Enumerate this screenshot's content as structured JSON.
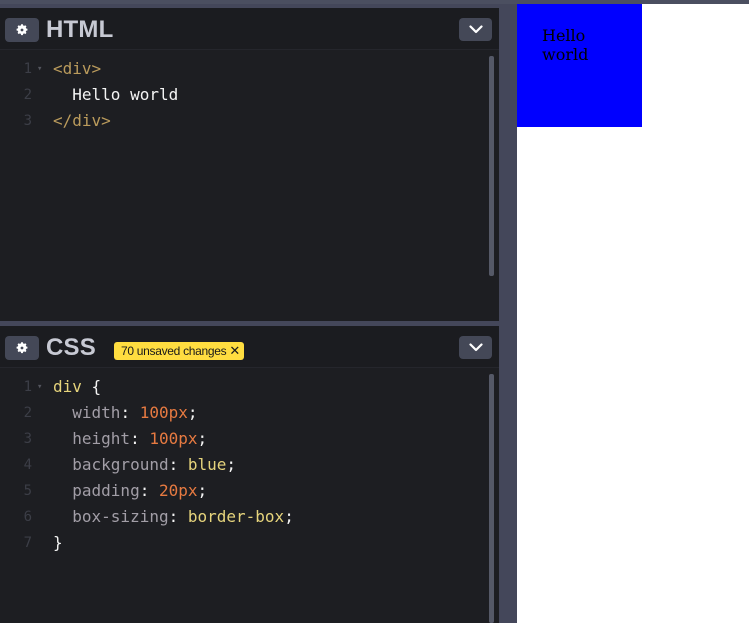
{
  "html_panel": {
    "title": "HTML",
    "lines": [
      {
        "num": "1",
        "fold": "▾",
        "tokens": [
          {
            "cls": "t-tag",
            "text": "<div>"
          }
        ]
      },
      {
        "num": "2",
        "fold": "",
        "tokens": [
          {
            "cls": "t-text",
            "text": "  Hello world"
          }
        ]
      },
      {
        "num": "3",
        "fold": "",
        "tokens": [
          {
            "cls": "t-tag",
            "text": "</div>"
          }
        ]
      }
    ]
  },
  "css_panel": {
    "title": "CSS",
    "badge": "70 unsaved changes",
    "badge_close": "✕",
    "lines": [
      {
        "num": "1",
        "fold": "▾",
        "tokens": [
          {
            "cls": "t-selector",
            "text": "div "
          },
          {
            "cls": "t-punc",
            "text": "{"
          }
        ]
      },
      {
        "num": "2",
        "fold": "",
        "tokens": [
          {
            "cls": "t-prop",
            "text": "  width"
          },
          {
            "cls": "t-punc",
            "text": ": "
          },
          {
            "cls": "t-num",
            "text": "100px"
          },
          {
            "cls": "t-punc",
            "text": ";"
          }
        ]
      },
      {
        "num": "3",
        "fold": "",
        "tokens": [
          {
            "cls": "t-prop",
            "text": "  height"
          },
          {
            "cls": "t-punc",
            "text": ": "
          },
          {
            "cls": "t-num",
            "text": "100px"
          },
          {
            "cls": "t-punc",
            "text": ";"
          }
        ]
      },
      {
        "num": "4",
        "fold": "",
        "tokens": [
          {
            "cls": "t-prop",
            "text": "  background"
          },
          {
            "cls": "t-punc",
            "text": ": "
          },
          {
            "cls": "t-val",
            "text": "blue"
          },
          {
            "cls": "t-punc",
            "text": ";"
          }
        ]
      },
      {
        "num": "5",
        "fold": "",
        "tokens": [
          {
            "cls": "t-prop",
            "text": "  padding"
          },
          {
            "cls": "t-punc",
            "text": ": "
          },
          {
            "cls": "t-num",
            "text": "20px"
          },
          {
            "cls": "t-punc",
            "text": ";"
          }
        ]
      },
      {
        "num": "6",
        "fold": "",
        "tokens": [
          {
            "cls": "t-prop",
            "text": "  box-sizing"
          },
          {
            "cls": "t-punc",
            "text": ": "
          },
          {
            "cls": "t-val",
            "text": "border-box"
          },
          {
            "cls": "t-punc",
            "text": ";"
          }
        ]
      },
      {
        "num": "7",
        "fold": "",
        "tokens": [
          {
            "cls": "t-punc",
            "text": "}"
          }
        ]
      }
    ]
  },
  "preview": {
    "text": "Hello world",
    "box_color": "#0000ff"
  },
  "icons": {
    "settings": "gear-icon",
    "collapse": "chevron-down-icon",
    "dismiss": "close-icon"
  }
}
